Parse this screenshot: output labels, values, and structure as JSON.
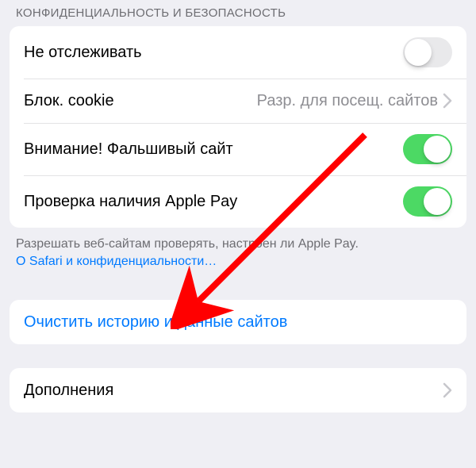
{
  "section": {
    "header": "КОНФИДЕНЦИАЛЬНОСТЬ И БЕЗОПАСНОСТЬ",
    "rows": {
      "do_not_track": {
        "label": "Не отслеживать",
        "on": false
      },
      "block_cookies": {
        "label": "Блок. cookie",
        "value": "Разр. для посещ. сайтов"
      },
      "fraud_warning": {
        "label": "Внимание! Фальшивый сайт",
        "on": true
      },
      "apple_pay_check": {
        "label": "Проверка наличия Apple Pay",
        "on": true
      }
    },
    "footer": {
      "text": "Разрешать веб-сайтам проверять, настроен ли Apple Pay.",
      "link": "О Safari и конфиденциальности…"
    }
  },
  "clear_history": {
    "label": "Очистить историю и данные сайтов"
  },
  "addons": {
    "label": "Дополнения"
  }
}
